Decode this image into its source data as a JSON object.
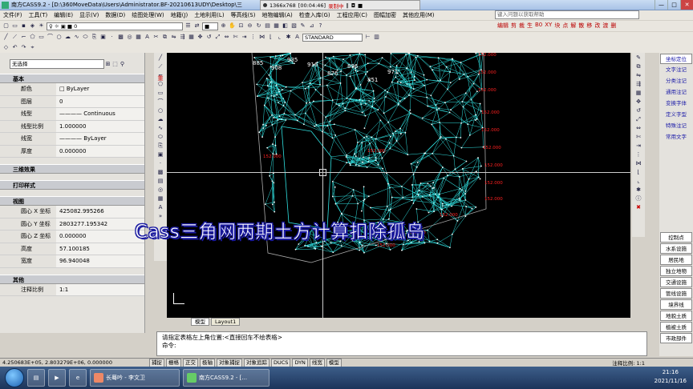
{
  "window": {
    "title": "南方CASS9.2 - [D:\\360MoveData\\Users\\Administrator.BF-20210613UDY\\Desktop\\三",
    "buttons": [
      "—",
      "□",
      "✕"
    ]
  },
  "recorder": {
    "size": "1366x768",
    "timer": "[00:04:46]",
    "label": "录制中"
  },
  "menu": [
    "文件(F)",
    "工具(T)",
    "编辑(E)",
    "显示(V)",
    "数据(D)",
    "绘图处理(W)",
    "地籍(J)",
    "土地利用(L)",
    "等高线(S)",
    "地物编辑(A)",
    "检查入库(G)",
    "工程应用(C)",
    "图幅加密",
    "其他应用(M)"
  ],
  "search": {
    "placeholder": "键入问题以获取帮助"
  },
  "toolbar": {
    "layer_value": "0",
    "text_style": "STANDARD",
    "cass_tools": [
      "编辑",
      "剪",
      "裁",
      "生",
      "B0",
      "XY",
      "块",
      "点",
      "解",
      "散",
      "移",
      "改",
      "渡",
      "删"
    ]
  },
  "properties": {
    "selection": "无选择",
    "sections": [
      {
        "title": "基本",
        "rows": [
          {
            "key": "颜色",
            "value": "ByLayer"
          },
          {
            "key": "图层",
            "value": "0"
          },
          {
            "key": "线型",
            "value": "———— Continuous"
          },
          {
            "key": "线型比例",
            "value": "1.000000"
          },
          {
            "key": "线宽",
            "value": "———— ByLayer"
          },
          {
            "key": "厚度",
            "value": "0.000000"
          }
        ]
      },
      {
        "title": "三维效果",
        "rows": []
      },
      {
        "title": "打印样式",
        "rows": []
      },
      {
        "title": "视图",
        "rows": [
          {
            "key": "圆心 X 坐标",
            "value": "425082.995266"
          },
          {
            "key": "圆心 Y 坐标",
            "value": "2803277.195342"
          },
          {
            "key": "圆心 Z 坐标",
            "value": "0.000000"
          },
          {
            "key": "高度",
            "value": "57.100185"
          },
          {
            "key": "宽度",
            "value": "96.940048"
          }
        ]
      },
      {
        "title": "其他",
        "rows": [
          {
            "key": "注释比例",
            "value": "1:1"
          }
        ]
      }
    ]
  },
  "canvas": {
    "elevation_labels": [
      "152.000",
      "152.000",
      "152.000",
      "152.000",
      "152.000",
      "152.000",
      "152.000",
      "152.000",
      "152.000",
      "152.000",
      "152.000",
      "152.000",
      "152.000",
      "152.000"
    ],
    "point_labels": [
      "885",
      "908",
      "935",
      "916",
      "876",
      "896",
      "851",
      "971"
    ],
    "colors": {
      "mesh": "#2fe0e0",
      "points": "#ffffff",
      "labels": "#ff2020",
      "background": "#000000"
    }
  },
  "layout_tabs": [
    "模型",
    "Layout1"
  ],
  "command": {
    "line1": "请指定表格左上角位置:<直接回车不绘表格>",
    "prompt": "命令:"
  },
  "caption": "Cass三角网两期土方计算扣除孤岛",
  "right_panel": {
    "top_items": [
      "坐标定位",
      "文字注记",
      "分类注记",
      "通用注记",
      "变换字体",
      "定义字型",
      "特殊注记",
      "常用文字"
    ],
    "bottom_items": [
      "控制点",
      "水系设施",
      "居民地",
      "独立地物",
      "交通设施",
      "管线设施",
      "境界线",
      "地貌土质",
      "植被土质",
      "市政部件"
    ]
  },
  "status": {
    "coords": "4.250683E+05, 2.803279E+06, 0.000000",
    "toggles": [
      "捕捉",
      "栅格",
      "正交",
      "极轴",
      "对象捕捉",
      "对象追踪",
      "DUCS",
      "DYN",
      "线宽",
      "模型"
    ],
    "scale": "注释比例: 1:1"
  },
  "taskbar": {
    "items": [
      "长蓦吟 - 李文卫",
      "南方CASS9.2 - [..."
    ],
    "time": "21:16",
    "date": "2021/11/16"
  }
}
